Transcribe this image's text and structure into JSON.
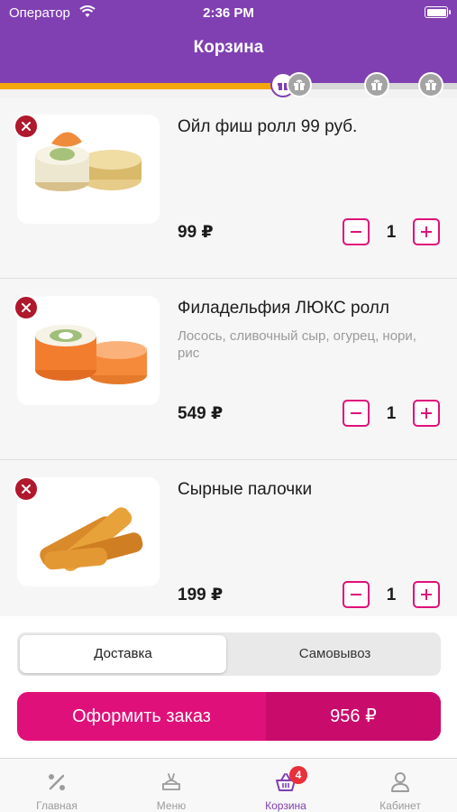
{
  "status_bar": {
    "carrier": "Оператор",
    "time": "2:36 PM"
  },
  "header": {
    "title": "Корзина"
  },
  "progress": {
    "fraction": 0.61
  },
  "cart": {
    "items": [
      {
        "name": "Ойл фиш ролл 99 руб.",
        "description": "",
        "price": "99 ₽",
        "quantity": "1"
      },
      {
        "name": "Филадельфия ЛЮКС ролл",
        "description": "Лосось, сливочный сыр, огурец, нори, рис",
        "price": "549 ₽",
        "quantity": "1"
      },
      {
        "name": "Сырные палочки",
        "description": "",
        "price": "199 ₽",
        "quantity": "1"
      }
    ]
  },
  "delivery": {
    "options": [
      "Доставка",
      "Самовывоз"
    ],
    "selected": "Доставка"
  },
  "checkout": {
    "label": "Оформить заказ",
    "total": "956 ₽"
  },
  "tabbar": {
    "tabs": [
      {
        "label": "Главная",
        "icon": "percent-icon"
      },
      {
        "label": "Меню",
        "icon": "menu-icon"
      },
      {
        "label": "Корзина",
        "icon": "basket-icon",
        "badge": "4",
        "active": true
      },
      {
        "label": "Кабинет",
        "icon": "user-icon"
      }
    ]
  },
  "colors": {
    "brand": "#8040b2",
    "accent": "#e0107a",
    "remove": "#b0182b",
    "progress": "#f4a60d"
  }
}
